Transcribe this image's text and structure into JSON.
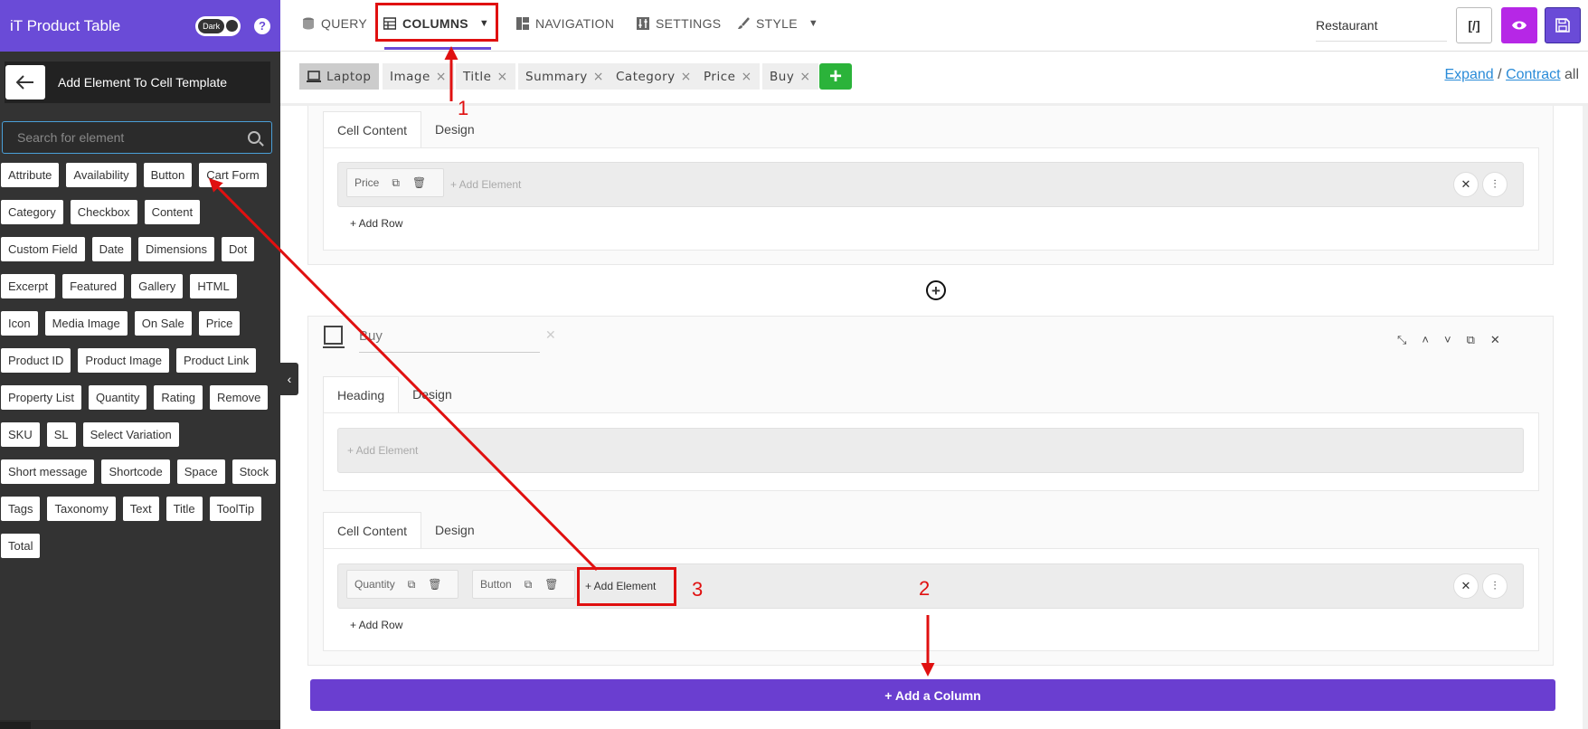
{
  "sidebar": {
    "title": "iT Product Table",
    "dark_toggle_label": "Dark",
    "help_label": "?",
    "back_panel_title": "Add Element To Cell Template",
    "search_placeholder": "Search for element",
    "elements": [
      "Attribute",
      "Availability",
      "Button",
      "Cart Form",
      "Category",
      "Checkbox",
      "Content",
      "Custom Field",
      "Date",
      "Dimensions",
      "Dot",
      "Excerpt",
      "Featured",
      "Gallery",
      "HTML",
      "Icon",
      "Media Image",
      "On Sale",
      "Price",
      "Product ID",
      "Product Image",
      "Product Link",
      "Property List",
      "Quantity",
      "Rating",
      "Remove",
      "SKU",
      "SL",
      "Select Variation",
      "Short message",
      "Shortcode",
      "Space",
      "Stock",
      "Tags",
      "Taxonomy",
      "Text",
      "Title",
      "ToolTip",
      "Total"
    ]
  },
  "topnav": {
    "tabs": [
      {
        "label": "QUERY",
        "icon": "database-icon"
      },
      {
        "label": "COLUMNS",
        "icon": "table-icon"
      },
      {
        "label": "NAVIGATION",
        "icon": "layout-icon"
      },
      {
        "label": "SETTINGS",
        "icon": "sliders-icon"
      },
      {
        "label": "STYLE",
        "icon": "brush-icon"
      }
    ],
    "preset_value": "Restaurant",
    "shortcode_label": "[/]"
  },
  "column_bar": {
    "device": "Laptop",
    "columns": [
      "Image",
      "Title",
      "Summary",
      "Category",
      "Price",
      "Buy"
    ],
    "expand_label": "Expand",
    "separator": "/",
    "contract_label": "Contract",
    "all_label": "all"
  },
  "price_column": {
    "tabs": [
      "Cell Content",
      "Design"
    ],
    "elements": [
      {
        "label": "Price"
      }
    ],
    "add_element_label": "+ Add Element",
    "add_row_label": "+ Add Row"
  },
  "buy_column": {
    "name_value": "Buy",
    "heading_tabs": [
      "Heading",
      "Design"
    ],
    "heading_add_element": "+ Add Element",
    "cell_tabs": [
      "Cell Content",
      "Design"
    ],
    "elements": [
      {
        "label": "Quantity"
      },
      {
        "label": "Button"
      }
    ],
    "add_element_label": "+ Add Element",
    "add_row_label": "+ Add Row"
  },
  "add_column_label": "+ Add a Column",
  "annotations": [
    "1",
    "2",
    "3"
  ],
  "colors": {
    "accent": "#6a4bd7",
    "annotation": "#e01010",
    "add_green": "#2bb33a",
    "preview_purple": "#b627e6"
  }
}
